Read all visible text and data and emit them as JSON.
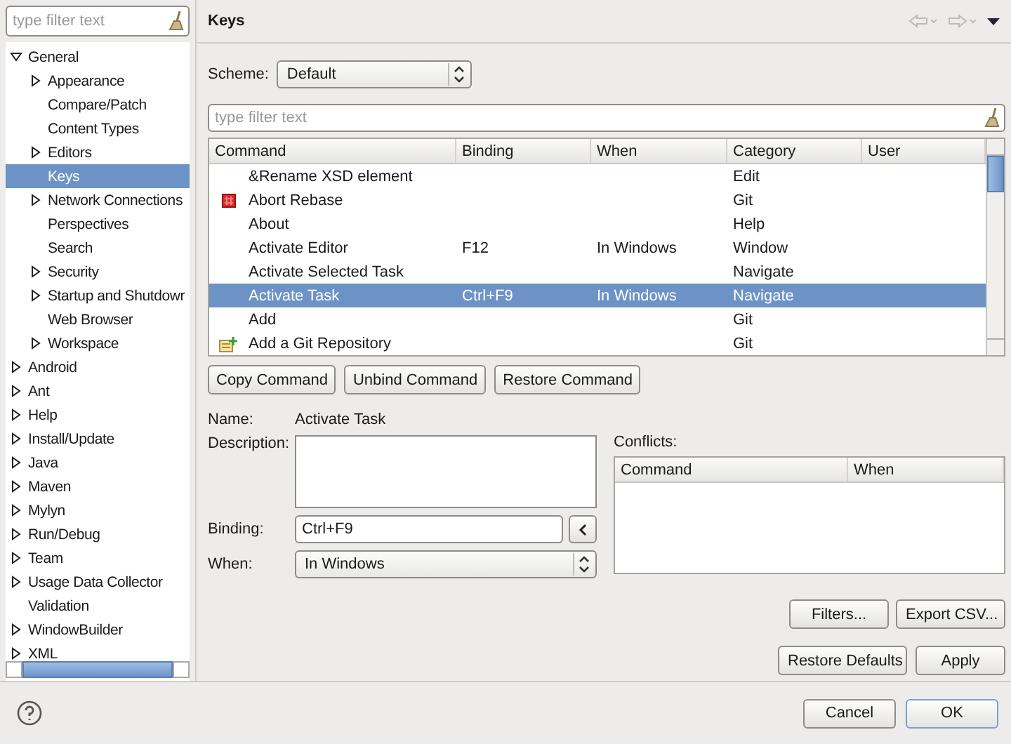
{
  "tree": {
    "filter_placeholder": "type filter text",
    "items": [
      {
        "label": "General",
        "expanded": true,
        "selected": false,
        "children": [
          {
            "label": "Appearance",
            "expanded": false,
            "selected": false
          },
          {
            "label": "Compare/Patch",
            "selected": false
          },
          {
            "label": "Content Types",
            "selected": false
          },
          {
            "label": "Editors",
            "expanded": false,
            "selected": false
          },
          {
            "label": "Keys",
            "selected": true
          },
          {
            "label": "Network Connections",
            "expanded": false,
            "selected": false
          },
          {
            "label": "Perspectives",
            "selected": false
          },
          {
            "label": "Search",
            "selected": false
          },
          {
            "label": "Security",
            "expanded": false,
            "selected": false
          },
          {
            "label": "Startup and Shutdowr",
            "expanded": false,
            "selected": false
          },
          {
            "label": "Web Browser",
            "selected": false
          },
          {
            "label": "Workspace",
            "expanded": false,
            "selected": false
          }
        ]
      },
      {
        "label": "Android",
        "expanded": false,
        "selected": false
      },
      {
        "label": "Ant",
        "expanded": false,
        "selected": false
      },
      {
        "label": "Help",
        "expanded": false,
        "selected": false
      },
      {
        "label": "Install/Update",
        "expanded": false,
        "selected": false
      },
      {
        "label": "Java",
        "expanded": false,
        "selected": false
      },
      {
        "label": "Maven",
        "expanded": false,
        "selected": false
      },
      {
        "label": "Mylyn",
        "expanded": false,
        "selected": false
      },
      {
        "label": "Run/Debug",
        "expanded": false,
        "selected": false
      },
      {
        "label": "Team",
        "expanded": false,
        "selected": false
      },
      {
        "label": "Usage Data Collector",
        "expanded": false,
        "selected": false
      },
      {
        "label": "Validation",
        "selected": false
      },
      {
        "label": "WindowBuilder",
        "expanded": false,
        "selected": false
      },
      {
        "label": "XML",
        "expanded": false,
        "selected": false
      }
    ]
  },
  "page": {
    "title": "Keys",
    "scheme_label": "Scheme:",
    "scheme_value": "Default",
    "filter_placeholder": "type filter text",
    "table": {
      "columns": [
        "Command",
        "Binding",
        "When",
        "Category",
        "User"
      ],
      "rows": [
        {
          "kind": "plain",
          "selected": false,
          "command": "&Rename XSD element",
          "category": "Edit"
        },
        {
          "kind": "stop",
          "selected": false,
          "command": "Abort Rebase",
          "category": "Git"
        },
        {
          "kind": "plain",
          "selected": false,
          "command": "About",
          "category": "Help"
        },
        {
          "kind": "plain",
          "selected": false,
          "command": "Activate Editor",
          "binding": "F12",
          "when": "In Windows",
          "category": "Window"
        },
        {
          "kind": "plain",
          "selected": false,
          "command": "Activate Selected Task",
          "category": "Navigate"
        },
        {
          "kind": "plain",
          "selected": true,
          "command": "Activate Task",
          "binding": "Ctrl+F9",
          "when": "In Windows",
          "category": "Navigate"
        },
        {
          "kind": "plain",
          "selected": false,
          "command": "Add",
          "category": "Git"
        },
        {
          "kind": "repository",
          "selected": false,
          "command": "Add a Git Repository",
          "category": "Git"
        }
      ]
    },
    "command_buttons": [
      "Copy Command",
      "Unbind Command",
      "Restore Command"
    ],
    "name_label": "Name:",
    "name_value": "Activate Task",
    "description_label": "Description:",
    "binding_label": "Binding:",
    "binding_value": "Ctrl+F9",
    "when_label": "When:",
    "when_value": "In Windows",
    "conflicts_label": "Conflicts:",
    "conflicts_columns": [
      "Command",
      "When"
    ],
    "filter_buttons": [
      "Filters...",
      "Export CSV..."
    ],
    "page_buttons": [
      "Restore Defaults",
      "Apply"
    ]
  },
  "dialog_buttons": [
    {
      "label": "Cancel",
      "default": false
    },
    {
      "label": "OK",
      "default": true
    }
  ]
}
